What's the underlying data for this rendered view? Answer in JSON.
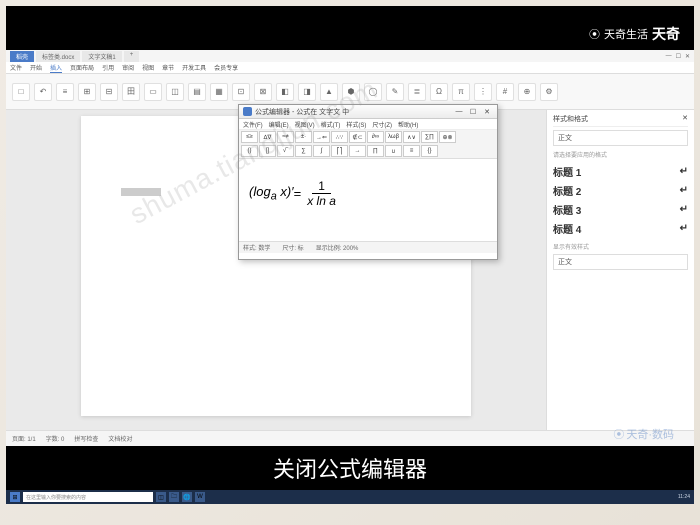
{
  "video": {
    "brand_logo": "天奇生活",
    "brand_extra": "天奇",
    "subtitle": "关闭公式编辑器",
    "watermark_url": "shuma.tianqijun.com",
    "bottom_watermark": "天奇·数码"
  },
  "app": {
    "title_tabs": [
      "稻壳",
      "标签类.docx",
      "文字文稿1"
    ],
    "window_controls": [
      "—",
      "☐",
      "✕"
    ],
    "ribbon_tabs": [
      "文件",
      "开始",
      "插入",
      "页面布局",
      "引用",
      "审阅",
      "视图",
      "章节",
      "开发工具",
      "会员专享"
    ],
    "toolbar_icons": [
      "□",
      "↶",
      "≡",
      "⊞",
      "⊟",
      "田",
      "▭",
      "◫",
      "▤",
      "▦",
      "⊡",
      "⊠",
      "◧",
      "◨",
      "▲",
      "⬢",
      "◯",
      "✎",
      "≣",
      "Ω",
      "π",
      "⋮",
      "#",
      "⊕",
      "⚙"
    ]
  },
  "side_panel": {
    "title": "样式和格式",
    "close": "✕",
    "current_style": "正文",
    "format_hint": "请选择要应用的格式",
    "styles": [
      "标题 1",
      "标题 2",
      "标题 3",
      "标题 4"
    ],
    "show_label": "显示有效样式",
    "show_value": "正文"
  },
  "equation_editor": {
    "title": "公式编辑器 - 公式在 文字文 中",
    "menu": [
      "文件(F)",
      "编辑(E)",
      "视图(V)",
      "格式(T)",
      "样式(S)",
      "尺寸(Z)",
      "帮助(H)"
    ],
    "tools_row1": [
      "≤≥",
      "∆∇",
      "≈≠",
      "±·",
      "→⇐",
      "∴∵",
      "∉⊂",
      "∂∞",
      "λωβ",
      "∧∨",
      "∑∏",
      "⊕⊗"
    ],
    "tools_row2": [
      "()",
      "[]",
      "√‾",
      "∑",
      "∫",
      "⎡⎤",
      "→",
      "∏",
      "∪",
      "≡",
      "{}"
    ],
    "equation_lhs": "(log",
    "equation_sub": "a",
    "equation_var": " x)′",
    "equation_eq": " = ",
    "equation_num": "1",
    "equation_den": "x ln a",
    "status_left": "样式: 数学",
    "status_mid": "尺寸: 标",
    "status_right": "显示比例: 200%"
  },
  "statusbar": {
    "page": "页面: 1/1",
    "words": "字数: 0",
    "spell": "拼写检查",
    "doccheck": "文档校对"
  },
  "taskbar": {
    "search_placeholder": "在这里输入你要搜索的内容",
    "time": "11:24"
  }
}
